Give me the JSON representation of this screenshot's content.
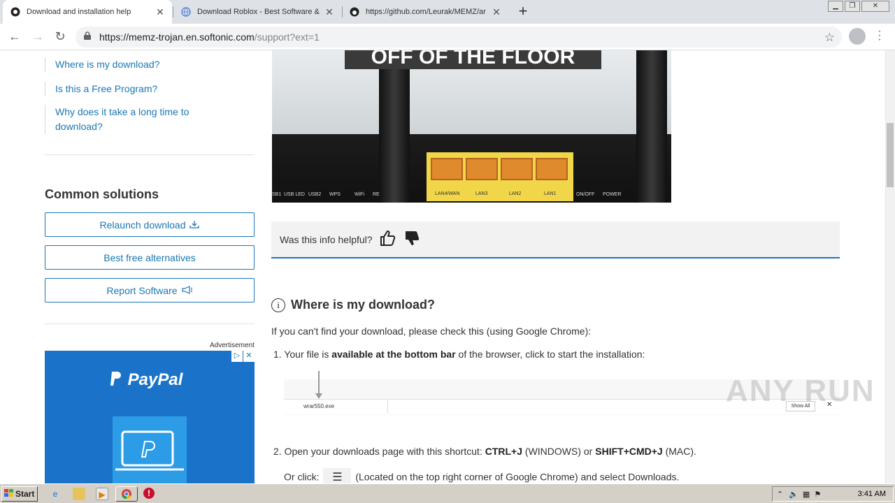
{
  "tabs": [
    {
      "label": "Download and installation help",
      "active": true
    },
    {
      "label": "Download Roblox - Best Software &",
      "active": false
    },
    {
      "label": "https://github.com/Leurak/MEMZ/ar",
      "active": false
    }
  ],
  "address": {
    "host": "https://memz-trojan.en.softonic.com",
    "path": "/support?ext=1"
  },
  "sidebar": {
    "links": [
      "Where is my download?",
      "Is this a Free Program?",
      "Why does it take a long time to",
      "download?"
    ],
    "common_title": "Common solutions",
    "buttons": [
      "Relaunch download",
      "Best free alternatives",
      "Report Software"
    ],
    "ad_label": "Advertisement",
    "ad_brand": "PayPal"
  },
  "router": {
    "caption": "OFF OF THE FLOOR",
    "port_labels": [
      "LAN4/WAN",
      "LAN3",
      "LAN2",
      "LAN1"
    ],
    "panel_labels": [
      "SB1",
      "USB LED",
      "USB2",
      "WPS",
      "WiFi",
      "RE",
      "ON/OFF",
      "POWER"
    ]
  },
  "helpful": {
    "question": "Was this info helpful?"
  },
  "article": {
    "title": "Where is my download?",
    "intro": "If you can't find your download, please check this (using Google Chrome):",
    "step1_pre": "1. Your file is ",
    "step1_bold": "available at the bottom bar",
    "step1_post": " of the browser, click to start the installation:",
    "dl_file": "wrar550.exe",
    "dl_show_all": "Show All",
    "step2_pre": "2. Open your downloads page with this shortcut: ",
    "step2_k1": "CTRL+J",
    "step2_mid": " (WINDOWS) or ",
    "step2_k2": "SHIFT+CMD+J",
    "step2_post": " (MAC).",
    "step2b_pre": "Or click: ",
    "step2b_post": " (Located on the top right corner of Google Chrome) and select Downloads."
  },
  "watermark": "ANY RUN",
  "taskbar": {
    "start": "Start",
    "time": "3:41 AM"
  }
}
